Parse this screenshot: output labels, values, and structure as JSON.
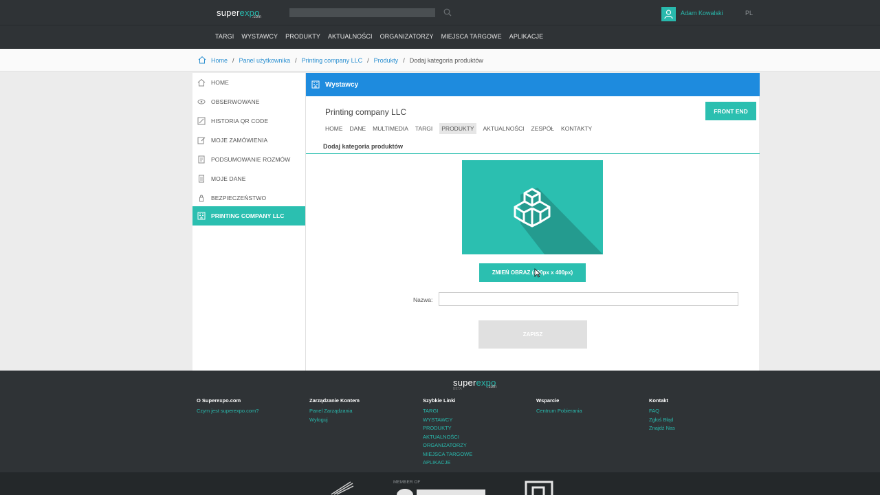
{
  "top": {
    "logo_main": "super",
    "logo_accent": "expo",
    "logo_sub": ".com",
    "user_name": "Adam Kowalski",
    "lang": "PL"
  },
  "nav": [
    "TARGI",
    "WYSTAWCY",
    "PRODUKTY",
    "AKTUALNOŚCI",
    "ORGANIZATORZY",
    "MIEJSCA TARGOWE",
    "APLIKACJE"
  ],
  "breadcrumb": [
    "Home",
    "Panel użytkownika",
    "Printing company LLC",
    "Produkty",
    "Dodaj kategoria produktów"
  ],
  "sidebar": [
    {
      "label": "HOME",
      "icon": "home-icon"
    },
    {
      "label": "OBSERWOWANE",
      "icon": "eye-icon"
    },
    {
      "label": "HISTORIA QR CODE",
      "icon": "qr-icon"
    },
    {
      "label": "MOJE ZAMÓWIENIA",
      "icon": "edit-icon"
    },
    {
      "label": "PODSUMOWANIE ROZMÓW",
      "icon": "document-icon"
    },
    {
      "label": "MOJE DANE",
      "icon": "list-icon"
    },
    {
      "label": "BEZPIECZEŃSTWO",
      "icon": "lock-icon"
    },
    {
      "label": "PRINTING COMPANY LLC",
      "icon": "building-icon",
      "active": true
    }
  ],
  "panel": {
    "header_title": "Wystawcy",
    "company_name": "Printing company LLC",
    "front_end_label": "FRONT END",
    "subnav": [
      "HOME",
      "DANE",
      "MULTIMEDIA",
      "TARGI",
      "PRODUKTY",
      "AKTUALNOŚCI",
      "ZESPÓŁ",
      "KONTAKTY"
    ],
    "active_subnav": "PRODUKTY",
    "section_title": "Dodaj kategoria produktów",
    "change_image_label": "ZMIEŃ OBRAZ (400px x 400px)",
    "name_label": "Nazwa:",
    "name_value": "",
    "save_label": "ZAPISZ"
  },
  "footer": {
    "beta": "BETA",
    "columns": [
      {
        "title": "O Superexpo.com",
        "links": [
          "Czym jest superexpo.com?"
        ]
      },
      {
        "title": "Zarządzanie Kontem",
        "links": [
          "Panel Zarządzania",
          "Wyloguj"
        ]
      },
      {
        "title": "Szybkie Linki",
        "links": [
          "TARGI",
          "WYSTAWCY",
          "PRODUKTY",
          "AKTUALNOŚCI",
          "ORGANIZATORZY",
          "MIEJSCA TARGOWE",
          "APLIKACJE"
        ]
      },
      {
        "title": "Wsparcie",
        "links": [
          "Centrum Pobierania"
        ]
      },
      {
        "title": "Kontakt",
        "links": [
          "FAQ",
          "Zgłoś Błąd",
          "Znajdź Nas"
        ]
      }
    ],
    "member_of": "MEMBER OF"
  },
  "colors": {
    "accent": "#2bbfb0",
    "header_blue": "#1e8bde",
    "dark_bg": "#2f3336",
    "link": "#2a8fd0"
  }
}
